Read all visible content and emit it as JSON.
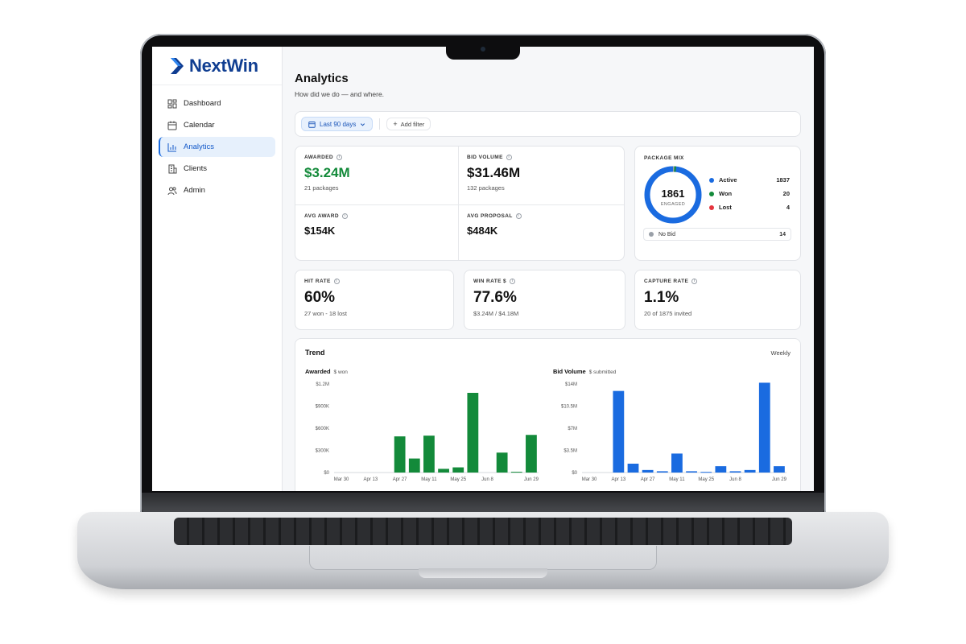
{
  "app": {
    "brand": "NextWin"
  },
  "sidebar": {
    "items": [
      {
        "label": "Dashboard",
        "icon": "dashboard-icon",
        "active": false
      },
      {
        "label": "Calendar",
        "icon": "calendar-icon",
        "active": false
      },
      {
        "label": "Analytics",
        "icon": "analytics-icon",
        "active": true
      },
      {
        "label": "Clients",
        "icon": "building-icon",
        "active": false
      },
      {
        "label": "Admin",
        "icon": "users-icon",
        "active": false
      }
    ]
  },
  "page": {
    "title": "Analytics",
    "subtitle": "How did we do — and where."
  },
  "filters": {
    "date_range": "Last 90 days",
    "add_filter": "Add filter"
  },
  "kpis": {
    "awarded": {
      "label": "AWARDED",
      "value": "$3.24M",
      "sub": "21 packages"
    },
    "bid_volume": {
      "label": "BID VOLUME",
      "value": "$31.46M",
      "sub": "132 packages"
    },
    "avg_award": {
      "label": "AVG AWARD",
      "value": "$154K"
    },
    "avg_proposal": {
      "label": "AVG PROPOSAL",
      "value": "$484K"
    },
    "hit_rate": {
      "label": "HIT RATE",
      "value": "60%",
      "sub": "27 won - 18 lost"
    },
    "win_rate": {
      "label": "WIN RATE $",
      "value": "77.6%",
      "sub": "$3.24M / $4.18M"
    },
    "capture_rate": {
      "label": "CAPTURE RATE",
      "value": "1.1%",
      "sub": "20 of 1875 invited"
    }
  },
  "package_mix": {
    "label": "PACKAGE MIX",
    "total": "1861",
    "total_label": "ENGAGED",
    "items": [
      {
        "name": "Active",
        "count": "1837",
        "color": "#1a6be0"
      },
      {
        "name": "Won",
        "count": "20",
        "color": "#138a3a"
      },
      {
        "name": "Lost",
        "count": "4",
        "color": "#e5353f"
      }
    ],
    "no_bid": {
      "name": "No Bid",
      "count": "14",
      "color": "#9aa0a8"
    }
  },
  "trend": {
    "title": "Trend",
    "period": "Weekly",
    "awarded": {
      "title": "Awarded",
      "unit": "$ won"
    },
    "bid_volume": {
      "title": "Bid Volume",
      "unit": "$ submitted"
    }
  },
  "chart_data": [
    {
      "type": "bar",
      "title": "Awarded",
      "subtitle": "$ won",
      "color": "#138a3a",
      "categories": [
        "Mar 30",
        "Apr 6",
        "Apr 13",
        "Apr 20",
        "Apr 27",
        "May 4",
        "May 11",
        "May 18",
        "May 25",
        "Jun 1",
        "Jun 8",
        "Jun 15",
        "Jun 22",
        "Jun 29"
      ],
      "tick_labels": [
        "Mar 30",
        "Apr 13",
        "Apr 27",
        "May 11",
        "May 25",
        "Jun 8",
        "Jun 29"
      ],
      "values": [
        0,
        0,
        0,
        0,
        490000,
        190000,
        500000,
        50000,
        70000,
        1080000,
        0,
        270000,
        10000,
        510000
      ],
      "yticks": [
        "$0",
        "$300K",
        "$600K",
        "$900K",
        "$1.2M"
      ],
      "ylim": [
        0,
        1200000
      ]
    },
    {
      "type": "bar",
      "title": "Bid Volume",
      "subtitle": "$ submitted",
      "color": "#1a6be0",
      "categories": [
        "Mar 30",
        "Apr 6",
        "Apr 13",
        "Apr 20",
        "Apr 27",
        "May 4",
        "May 11",
        "May 18",
        "May 25",
        "Jun 1",
        "Jun 8",
        "Jun 15",
        "Jun 22",
        "Jun 29"
      ],
      "tick_labels": [
        "Mar 30",
        "Apr 13",
        "Apr 27",
        "May 11",
        "May 25",
        "Jun 8",
        "Jun 29"
      ],
      "values": [
        0,
        0,
        12900000,
        1400000,
        400000,
        200000,
        3000000,
        200000,
        100000,
        1000000,
        200000,
        400000,
        14200000,
        1000000
      ],
      "yticks": [
        "$0",
        "$3.5M",
        "$7M",
        "$10.5M",
        "$14M"
      ],
      "ylim": [
        0,
        14000000
      ]
    }
  ]
}
